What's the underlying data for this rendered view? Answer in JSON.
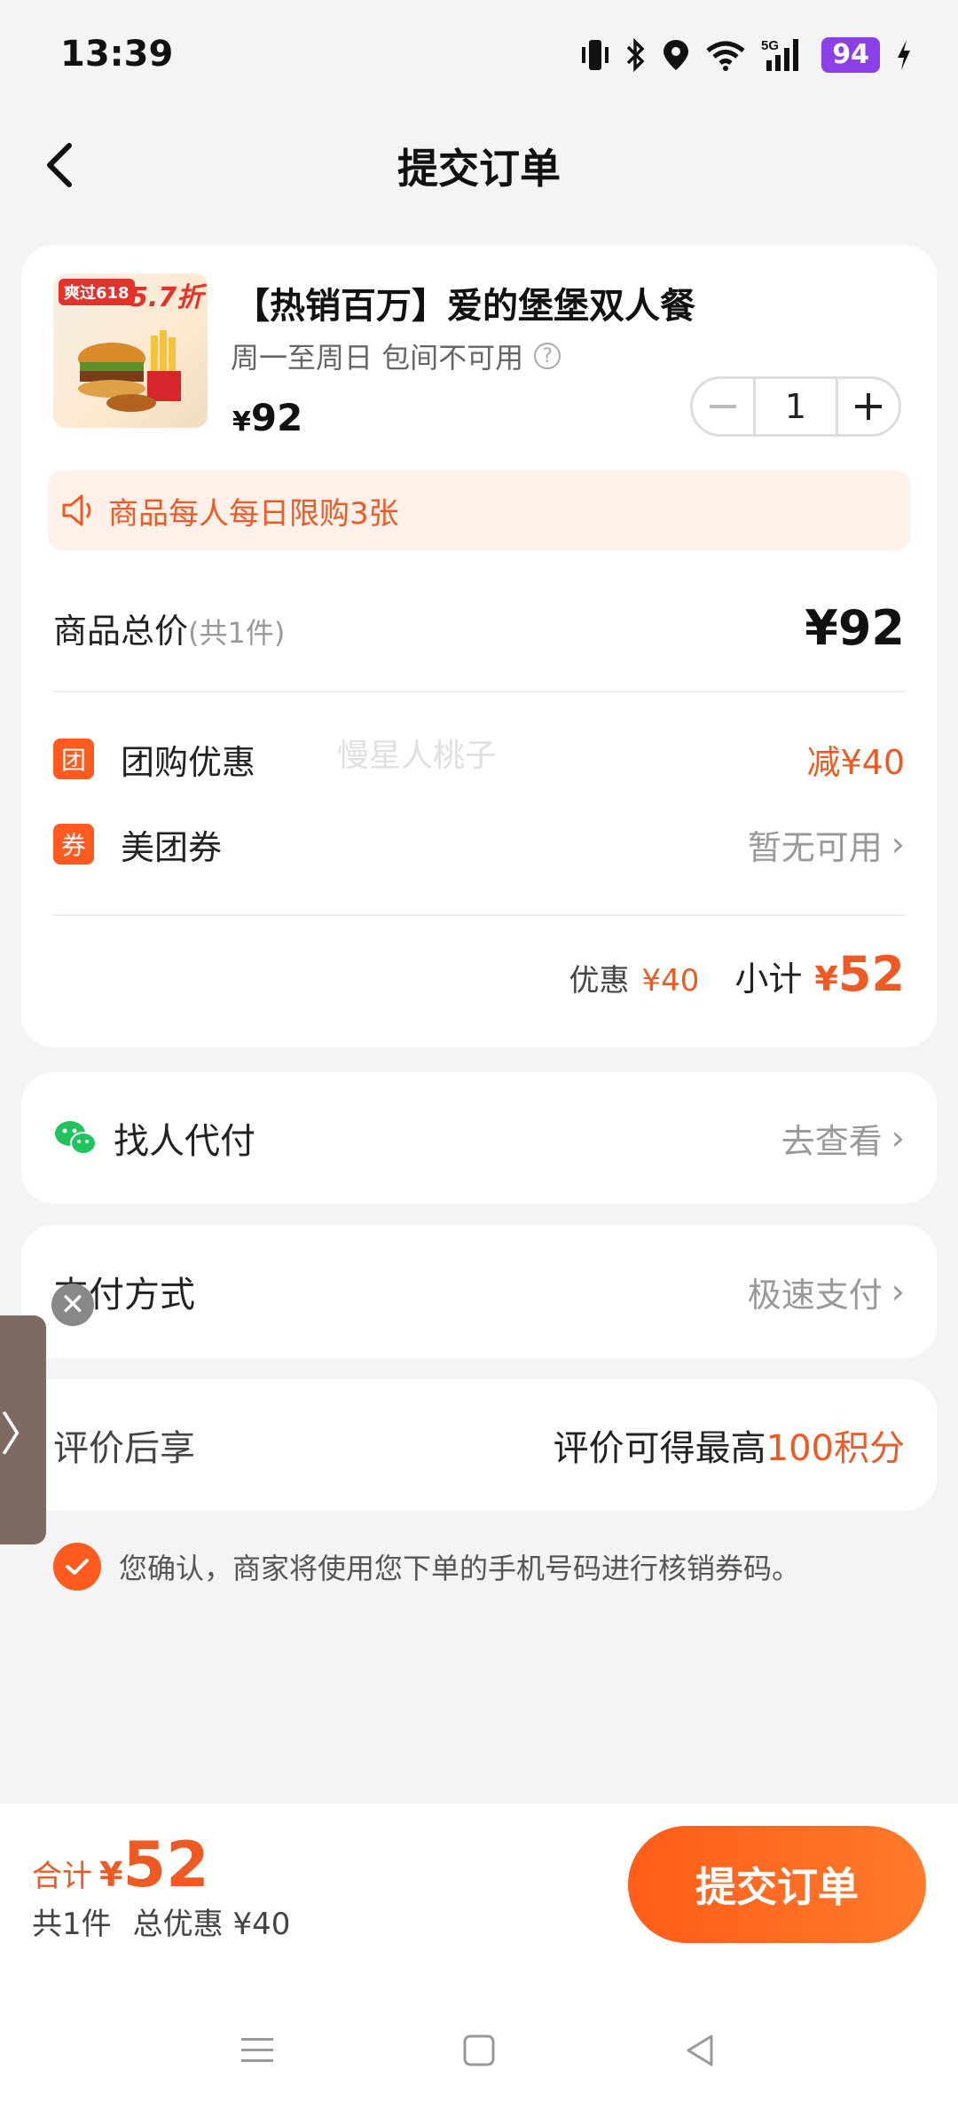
{
  "status": {
    "time": "13:39",
    "battery": "94",
    "network": "5G"
  },
  "header": {
    "title": "提交订单"
  },
  "product": {
    "image_badge": "爽过618",
    "image_discount": "5.7折",
    "name": "【热销百万】爱的堡堡双人餐",
    "subtitle": "周一至周日 包间不可用",
    "price_symbol": "¥",
    "price": "92",
    "quantity": "1"
  },
  "notice": {
    "text": "商品每人每日限购3张"
  },
  "summary": {
    "total_label": "商品总价",
    "total_count": "(共1件)",
    "total_price": "¥92",
    "group_tag": "团",
    "group_label": "团购优惠",
    "group_value": "减¥40",
    "coupon_tag": "券",
    "coupon_label": "美团券",
    "coupon_value": "暂无可用",
    "discount_label": "优惠",
    "discount_value": "¥40",
    "subtotal_label": "小计",
    "subtotal_symbol": "¥",
    "subtotal_value": "52",
    "watermark": "慢星人桃子"
  },
  "pay_for_me": {
    "label": "找人代付",
    "action": "去查看"
  },
  "payment": {
    "label": "支付方式",
    "value": "极速支付"
  },
  "review": {
    "label": "评价后享",
    "prefix": "评价可得最高",
    "highlight": "100积分"
  },
  "consent": {
    "text": "您确认，商家将使用您下单的手机号码进行核销券码。"
  },
  "footer": {
    "total_label": "合计",
    "total_symbol": "¥",
    "total_value": "52",
    "count_text": "共1件",
    "discount_text": "总优惠 ¥40",
    "submit_label": "提交订单"
  },
  "colors": {
    "accent": "#ee5a24",
    "button": "#ff6a22",
    "battery": "#8b3fe8",
    "wechat": "#21c35e"
  }
}
